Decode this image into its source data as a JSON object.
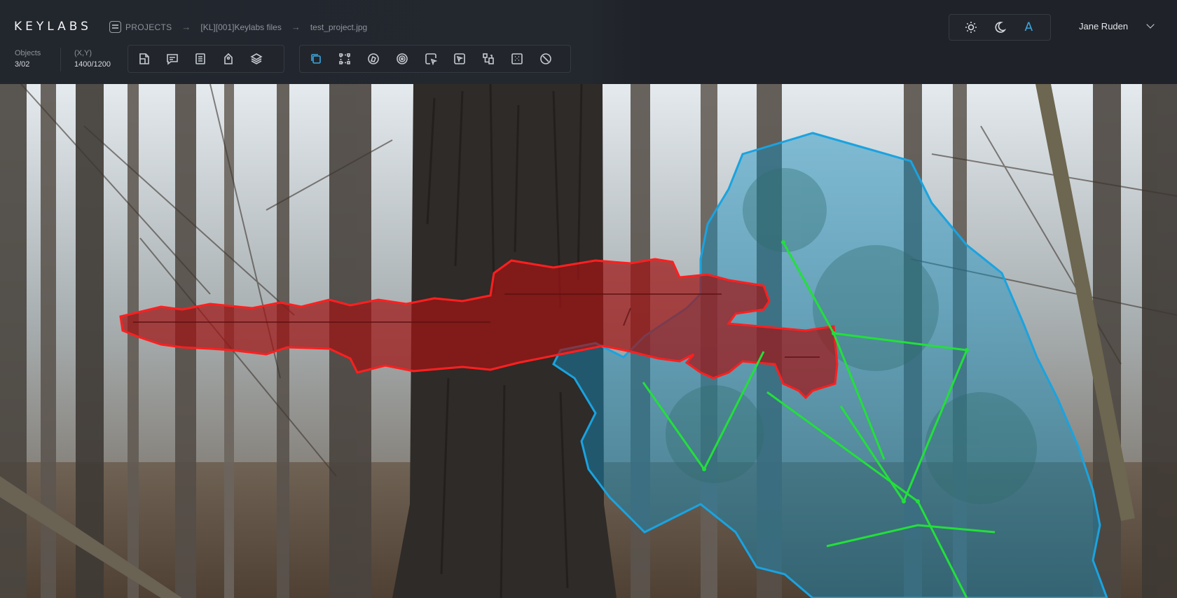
{
  "app": {
    "logo": "KEYLABS"
  },
  "breadcrumb": {
    "home": "PROJECTS",
    "folder": "[KL][001]Keylabs files",
    "file": "test_project.jpg",
    "separator": "→"
  },
  "stats": {
    "objects_label": "Objects",
    "objects_value": "3/02",
    "coords_label": "(X,Y)",
    "coords_value": "1400/1200"
  },
  "toolbar_left": {
    "icons": [
      "new-page-icon",
      "comment-icon",
      "list-icon",
      "tag-icon",
      "layers-icon"
    ]
  },
  "toolbar_annotation": {
    "icons": [
      "bounding-box-icon",
      "points-icon",
      "polygon-icon",
      "target-icon",
      "magic-select-icon",
      "cursor-select-icon",
      "cuboid-icon",
      "grid-icon",
      "cancel-icon"
    ],
    "active": "bounding-box-icon"
  },
  "theme": {
    "options": [
      "light-theme-icon",
      "dark-theme-icon",
      "auto-theme-icon"
    ],
    "auto_label": "A",
    "accent": "#3aa6e0"
  },
  "user": {
    "name": "Jane Ruden"
  },
  "annotations": {
    "colors": {
      "rifle": "#ff1f1f",
      "person": "#1aa3e0",
      "skeleton": "#22e03a"
    }
  }
}
